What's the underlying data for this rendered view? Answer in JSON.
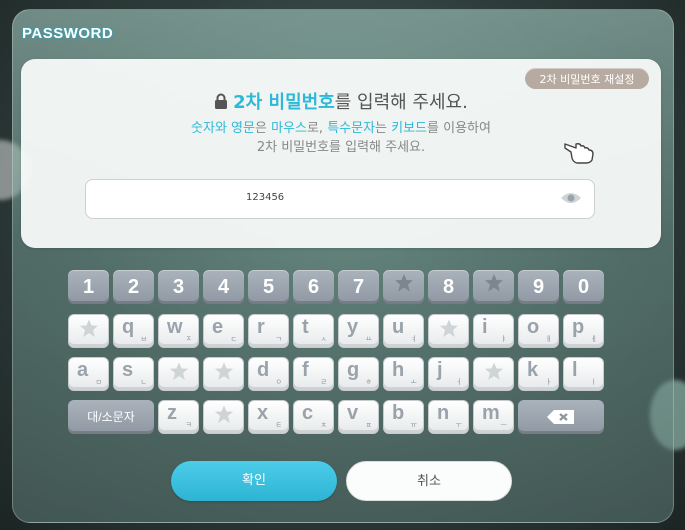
{
  "window": {
    "title": "PASSWORD"
  },
  "card": {
    "reset_label": "2차 비밀번호 재설정",
    "headline_hl": "2차 비밀번호",
    "headline_rest": "를 입력해 주세요.",
    "desc_line1": [
      {
        "t": "숫자와 영문",
        "hl": true
      },
      {
        "t": "은 ",
        "hl": false
      },
      {
        "t": "마우스",
        "hl": true
      },
      {
        "t": "로, ",
        "hl": false
      },
      {
        "t": "특수문자",
        "hl": true
      },
      {
        "t": "는 ",
        "hl": false
      },
      {
        "t": "키보드",
        "hl": true
      },
      {
        "t": "를 이용하여",
        "hl": false
      }
    ],
    "desc_line2": "2차 비밀번호를 입력해 주세요.",
    "password_value": "123456"
  },
  "keyboard": {
    "row1": [
      "1",
      "2",
      "3",
      "4",
      "5",
      "6",
      "7",
      "*",
      "8",
      "*",
      "9",
      "0"
    ],
    "row2": [
      [
        "*",
        ""
      ],
      [
        "q",
        "ㅂ"
      ],
      [
        "w",
        "ㅈ"
      ],
      [
        "e",
        "ㄷ"
      ],
      [
        "r",
        "ㄱ"
      ],
      [
        "t",
        "ㅅ"
      ],
      [
        "y",
        "ㅛ"
      ],
      [
        "u",
        "ㅕ"
      ],
      [
        "*",
        ""
      ],
      [
        "i",
        "ㅑ"
      ],
      [
        "o",
        "ㅐ"
      ],
      [
        "p",
        "ㅔ"
      ]
    ],
    "row3": [
      [
        "a",
        "ㅁ"
      ],
      [
        "s",
        "ㄴ"
      ],
      [
        "*",
        ""
      ],
      [
        "*",
        ""
      ],
      [
        "d",
        "ㅇ"
      ],
      [
        "f",
        "ㄹ"
      ],
      [
        "g",
        "ㅎ"
      ],
      [
        "h",
        "ㅗ"
      ],
      [
        "j",
        "ㅓ"
      ],
      [
        "*",
        ""
      ],
      [
        "k",
        "ㅏ"
      ],
      [
        "l",
        "ㅣ"
      ]
    ],
    "row4": [
      [
        "z",
        "ㅋ"
      ],
      [
        "*",
        ""
      ],
      [
        "x",
        "ㅌ"
      ],
      [
        "c",
        "ㅊ"
      ],
      [
        "v",
        "ㅍ"
      ],
      [
        "b",
        "ㅠ"
      ],
      [
        "n",
        "ㅜ"
      ],
      [
        "m",
        "ㅡ"
      ]
    ],
    "shift_label": "대/소문자"
  },
  "buttons": {
    "confirm": "확인",
    "cancel": "취소"
  },
  "colors": {
    "accent": "#2eb8d8",
    "key_dark": "#9aa3ac",
    "key_light": "#ffffff"
  }
}
